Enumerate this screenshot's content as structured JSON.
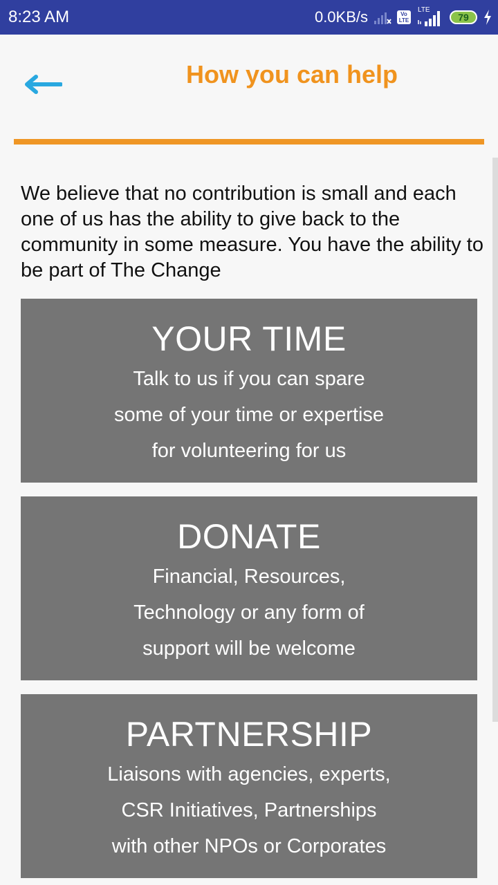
{
  "status_bar": {
    "time": "8:23 AM",
    "net_speed": "0.0KB/s",
    "volte_label": "Vo LTE",
    "lte_label": "LTE",
    "battery": "79"
  },
  "header": {
    "title": "How you can help",
    "back_icon": "arrow-left-icon",
    "accent_color": "#f0931e",
    "back_icon_color": "#29a8e0"
  },
  "intro": "We believe that no contribution is small and each one of us has the ability to give back to the community in some measure. You have the ability to be part of The Change",
  "cards": [
    {
      "title": "YOUR TIME",
      "lines": [
        "Talk to us if you can spare",
        "some of your time or expertise",
        "for volunteering for us"
      ]
    },
    {
      "title": "DONATE",
      "lines": [
        "Financial, Resources,",
        "Technology or any form of",
        "support will be welcome"
      ]
    },
    {
      "title": "PARTNERSHIP",
      "lines": [
        "Liaisons with agencies, experts,",
        "CSR Initiatives, Partnerships",
        "with other NPOs or Corporates"
      ]
    }
  ],
  "colors": {
    "status_bar": "#303f9f",
    "card_background": "#757575",
    "divider": "#ef9625"
  }
}
